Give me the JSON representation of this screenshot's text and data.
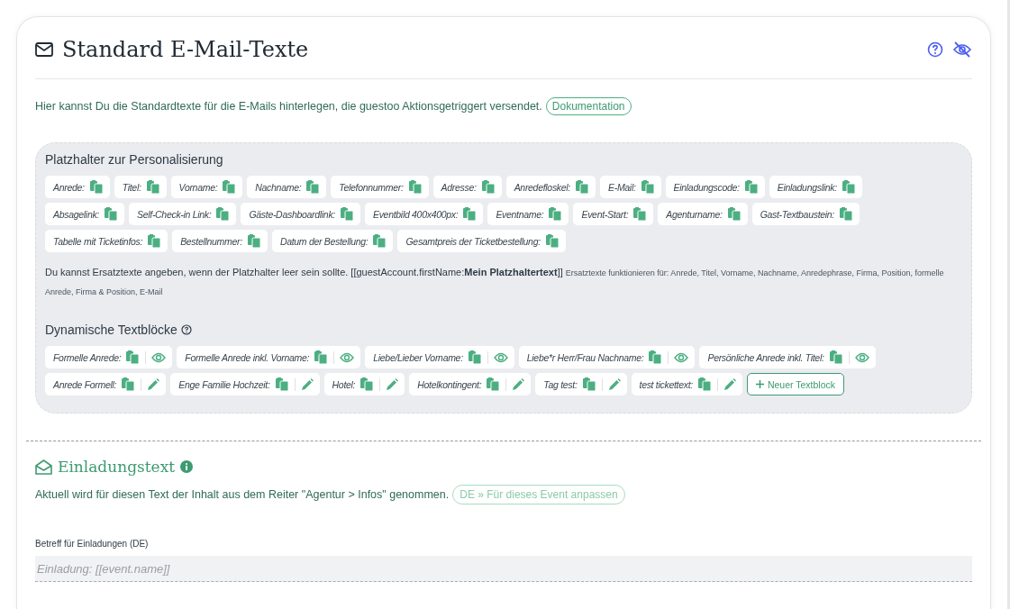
{
  "card": {
    "title": "Standard E-Mail-Texte",
    "intro": "Hier kannst Du die Standardtexte für die E-Mails hinterlegen, die guestoo Aktionsgetriggert versendet.",
    "doc_link": "Dokumentation"
  },
  "placeholders": {
    "heading": "Platzhalter zur Personalisierung",
    "rows": [
      {
        "chips": [
          "Anrede:",
          "Titel:",
          "Vorname:",
          "Nachname:",
          "Telefonnummer:",
          "Adresse:",
          "Anredefloskel:",
          "E-Mail:",
          "Einladungscode:",
          "Einladungslink:"
        ]
      },
      {
        "chips": [
          "Absagelink:",
          "Self-Check-in Link:",
          "Gäste-Dashboardlink:",
          "Eventbild 400x400px:",
          "Eventname:",
          "Event-Start:",
          "Agenturname:",
          "Gast-Textbaustein:"
        ]
      },
      {
        "chips": [
          "Tabelle mit Ticketinfos:",
          "Bestellnummer:",
          "Datum der Bestellung:",
          "Gesamtpreis der Ticketbestellung:"
        ]
      }
    ],
    "hint": "Du kannst Ersatztexte angeben, wenn der Platzhalter leer sein sollte. [[guestAccount.firstName:**Mein Platzhaltertext**]]",
    "note": "Ersatztexte funktionieren für: Anrede, Titel, Vorname, Nachname, Anredephrase, Firma, Position, formelle Anrede, Firma & Position, E-Mail"
  },
  "dynamic": {
    "heading": "Dynamische Textblöcke",
    "rows": [
      {
        "blocks": [
          {
            "label": "Formelle Anrede:",
            "kind": "preview"
          },
          {
            "label": "Formelle Anrede inkl. Vorname:",
            "kind": "preview"
          },
          {
            "label": "Liebe/Lieber Vorname:",
            "kind": "preview"
          },
          {
            "label": "Liebe*r Herr/Frau Nachname:",
            "kind": "preview"
          },
          {
            "label": "Persönliche Anrede inkl. Titel:",
            "kind": "preview"
          }
        ]
      },
      {
        "blocks": [
          {
            "label": "Anrede Formell:",
            "kind": "editable"
          },
          {
            "label": "Enge Familie Hochzeit:",
            "kind": "editable"
          },
          {
            "label": "Hotel:",
            "kind": "editable"
          },
          {
            "label": "Hotelkontingent:",
            "kind": "editable"
          },
          {
            "label": "Tag test:",
            "kind": "editable"
          },
          {
            "label": "test tickettext:",
            "kind": "editable"
          }
        ]
      }
    ],
    "new_button": "Neuer Textblock"
  },
  "invitation": {
    "title": "Einladungstext",
    "info": "Aktuell wird für diesen Text der Inhalt aus dem Reiter \"Agentur > Infos\" genommen.",
    "customize_button": {
      "label": "DE » Für dieses Event anpassen",
      "disabled": true
    },
    "subject_label": "Betreff für Einladungen (DE)",
    "subject_placeholder": "Einladung: [[event.name]]"
  }
}
